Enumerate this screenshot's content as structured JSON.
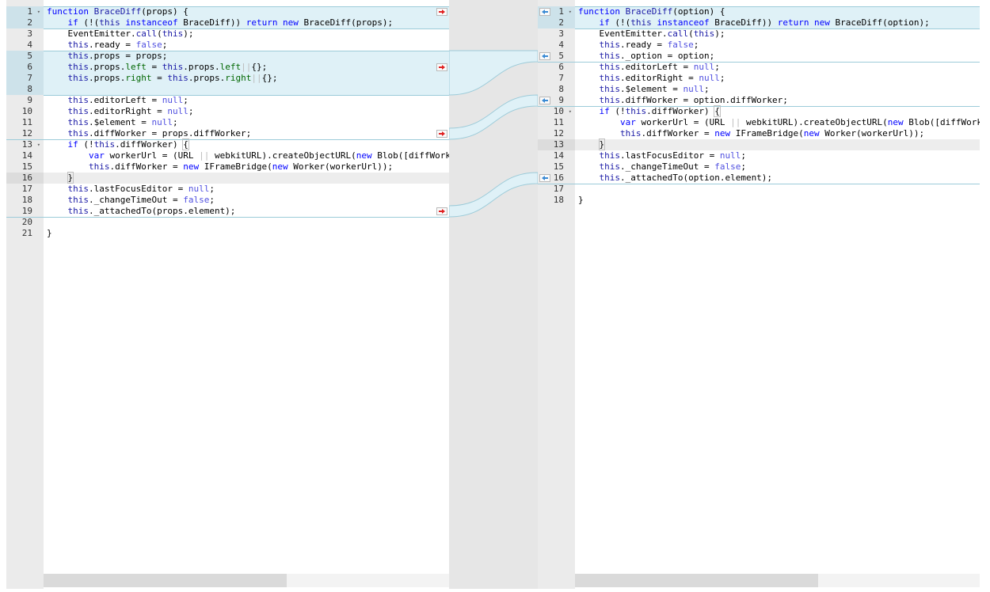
{
  "left": {
    "scroll_thumb_fraction": 0.6,
    "lines": [
      {
        "n": "1",
        "fold": true,
        "segs": [
          [
            "kw",
            "function "
          ],
          [
            "th",
            "BraceDiff"
          ],
          [
            "",
            "(props) {"
          ]
        ]
      },
      {
        "n": "2",
        "segs": [
          [
            "",
            "    "
          ],
          [
            "kw",
            "if"
          ],
          [
            "",
            " (!("
          ],
          [
            "th",
            "this"
          ],
          [
            "",
            " "
          ],
          [
            "kw",
            "instanceof"
          ],
          [
            "",
            " BraceDiff)) "
          ],
          [
            "kw",
            "return new"
          ],
          [
            "",
            " BraceDiff(props);"
          ]
        ]
      },
      {
        "n": "3",
        "segs": [
          [
            "",
            "    EventEmitter."
          ],
          [
            "th",
            "call"
          ],
          [
            "",
            "("
          ],
          [
            "th",
            "this"
          ],
          [
            "",
            ");"
          ]
        ]
      },
      {
        "n": "4",
        "segs": [
          [
            "",
            "    "
          ],
          [
            "th",
            "this"
          ],
          [
            "",
            ".ready = "
          ],
          [
            "nl",
            "false"
          ],
          [
            "",
            ";"
          ]
        ]
      },
      {
        "n": "5",
        "segs": [
          [
            "",
            "    "
          ],
          [
            "th",
            "this"
          ],
          [
            "",
            ".props = props;"
          ]
        ]
      },
      {
        "n": "6",
        "segs": [
          [
            "",
            "    "
          ],
          [
            "th",
            "this"
          ],
          [
            "",
            ".props."
          ],
          [
            "gr",
            "left"
          ],
          [
            "",
            " = "
          ],
          [
            "th",
            "this"
          ],
          [
            "",
            ".props."
          ],
          [
            "gr",
            "left"
          ],
          [
            "guide",
            "||"
          ],
          [
            "",
            "{};"
          ]
        ]
      },
      {
        "n": "7",
        "segs": [
          [
            "",
            "    "
          ],
          [
            "th",
            "this"
          ],
          [
            "",
            ".props."
          ],
          [
            "gr",
            "right"
          ],
          [
            "",
            " = "
          ],
          [
            "th",
            "this"
          ],
          [
            "",
            ".props."
          ],
          [
            "gr",
            "right"
          ],
          [
            "guide",
            "||"
          ],
          [
            "",
            "{};"
          ]
        ]
      },
      {
        "n": "8",
        "segs": []
      },
      {
        "n": "9",
        "segs": [
          [
            "",
            "    "
          ],
          [
            "th",
            "this"
          ],
          [
            "",
            ".editorLeft = "
          ],
          [
            "nl",
            "null"
          ],
          [
            "",
            ";"
          ]
        ]
      },
      {
        "n": "10",
        "segs": [
          [
            "",
            "    "
          ],
          [
            "th",
            "this"
          ],
          [
            "",
            ".editorRight = "
          ],
          [
            "nl",
            "null"
          ],
          [
            "",
            ";"
          ]
        ]
      },
      {
        "n": "11",
        "segs": [
          [
            "",
            "    "
          ],
          [
            "th",
            "this"
          ],
          [
            "",
            ".$element = "
          ],
          [
            "nl",
            "null"
          ],
          [
            "",
            ";"
          ]
        ]
      },
      {
        "n": "12",
        "segs": [
          [
            "",
            "    "
          ],
          [
            "th",
            "this"
          ],
          [
            "",
            ".diffWorker = props.diffWorker;"
          ]
        ]
      },
      {
        "n": "13",
        "fold": true,
        "segs": [
          [
            "",
            "    "
          ],
          [
            "kw",
            "if"
          ],
          [
            "",
            " (!"
          ],
          [
            "th",
            "this"
          ],
          [
            "",
            ".diffWorker) "
          ],
          [
            "brk",
            "{"
          ]
        ]
      },
      {
        "n": "14",
        "segs": [
          [
            "",
            "        "
          ],
          [
            "kw",
            "var"
          ],
          [
            "",
            " workerUrl = (URL "
          ],
          [
            "guide",
            "||"
          ],
          [
            "",
            " webkitURL).createObjectURL("
          ],
          [
            "kw",
            "new"
          ],
          [
            "",
            " Blob([diffWork"
          ]
        ]
      },
      {
        "n": "15",
        "segs": [
          [
            "",
            "        "
          ],
          [
            "th",
            "this"
          ],
          [
            "",
            ".diffWorker = "
          ],
          [
            "kw",
            "new"
          ],
          [
            "",
            " IFrameBridge("
          ],
          [
            "kw",
            "new"
          ],
          [
            "",
            " Worker(workerUrl));"
          ]
        ]
      },
      {
        "n": "16",
        "cur": true,
        "segs": [
          [
            "",
            "    "
          ],
          [
            "brk",
            "}"
          ]
        ]
      },
      {
        "n": "17",
        "segs": [
          [
            "",
            "    "
          ],
          [
            "th",
            "this"
          ],
          [
            "",
            ".lastFocusEditor = "
          ],
          [
            "nl",
            "null"
          ],
          [
            "",
            ";"
          ]
        ]
      },
      {
        "n": "18",
        "segs": [
          [
            "",
            "    "
          ],
          [
            "th",
            "this"
          ],
          [
            "",
            "._changeTimeOut = "
          ],
          [
            "nl",
            "false"
          ],
          [
            "",
            ";"
          ]
        ]
      },
      {
        "n": "19",
        "segs": [
          [
            "",
            "    "
          ],
          [
            "th",
            "this"
          ],
          [
            "",
            "._attachedTo(props.element);"
          ]
        ]
      },
      {
        "n": "20",
        "segs": []
      },
      {
        "n": "21",
        "segs": [
          [
            "",
            "}"
          ]
        ]
      }
    ]
  },
  "right": {
    "scroll_thumb_fraction": 0.6,
    "lines": [
      {
        "n": "1",
        "fold": true,
        "segs": [
          [
            "kw",
            "function "
          ],
          [
            "th",
            "BraceDiff"
          ],
          [
            "",
            "(option) {"
          ]
        ]
      },
      {
        "n": "2",
        "segs": [
          [
            "",
            "    "
          ],
          [
            "kw",
            "if"
          ],
          [
            "",
            " (!("
          ],
          [
            "th",
            "this"
          ],
          [
            "",
            " "
          ],
          [
            "kw",
            "instanceof"
          ],
          [
            "",
            " BraceDiff)) "
          ],
          [
            "kw",
            "return new"
          ],
          [
            "",
            " BraceDiff(option);"
          ]
        ]
      },
      {
        "n": "3",
        "segs": [
          [
            "",
            "    EventEmitter."
          ],
          [
            "th",
            "call"
          ],
          [
            "",
            "("
          ],
          [
            "th",
            "this"
          ],
          [
            "",
            ");"
          ]
        ]
      },
      {
        "n": "4",
        "segs": [
          [
            "",
            "    "
          ],
          [
            "th",
            "this"
          ],
          [
            "",
            ".ready = "
          ],
          [
            "nl",
            "false"
          ],
          [
            "",
            ";"
          ]
        ]
      },
      {
        "n": "5",
        "segs": [
          [
            "",
            "    "
          ],
          [
            "th",
            "this"
          ],
          [
            "",
            "._option = option;"
          ]
        ]
      },
      {
        "n": "6",
        "segs": [
          [
            "",
            "    "
          ],
          [
            "th",
            "this"
          ],
          [
            "",
            ".editorLeft = "
          ],
          [
            "nl",
            "null"
          ],
          [
            "",
            ";"
          ]
        ]
      },
      {
        "n": "7",
        "segs": [
          [
            "",
            "    "
          ],
          [
            "th",
            "this"
          ],
          [
            "",
            ".editorRight = "
          ],
          [
            "nl",
            "null"
          ],
          [
            "",
            ";"
          ]
        ]
      },
      {
        "n": "8",
        "segs": [
          [
            "",
            "    "
          ],
          [
            "th",
            "this"
          ],
          [
            "",
            ".$element = "
          ],
          [
            "nl",
            "null"
          ],
          [
            "",
            ";"
          ]
        ]
      },
      {
        "n": "9",
        "segs": [
          [
            "",
            "    "
          ],
          [
            "th",
            "this"
          ],
          [
            "",
            ".diffWorker = option.diffWorker;"
          ]
        ]
      },
      {
        "n": "10",
        "fold": true,
        "segs": [
          [
            "",
            "    "
          ],
          [
            "kw",
            "if"
          ],
          [
            "",
            " (!"
          ],
          [
            "th",
            "this"
          ],
          [
            "",
            ".diffWorker) "
          ],
          [
            "brk",
            "{"
          ]
        ]
      },
      {
        "n": "11",
        "segs": [
          [
            "",
            "        "
          ],
          [
            "kw",
            "var"
          ],
          [
            "",
            " workerUrl = (URL "
          ],
          [
            "guide",
            "||"
          ],
          [
            "",
            " webkitURL).createObjectURL("
          ],
          [
            "kw",
            "new"
          ],
          [
            "",
            " Blob([diffWork"
          ]
        ]
      },
      {
        "n": "12",
        "segs": [
          [
            "",
            "        "
          ],
          [
            "th",
            "this"
          ],
          [
            "",
            ".diffWorker = "
          ],
          [
            "kw",
            "new"
          ],
          [
            "",
            " IFrameBridge("
          ],
          [
            "kw",
            "new"
          ],
          [
            "",
            " Worker(workerUrl));"
          ]
        ]
      },
      {
        "n": "13",
        "cur": true,
        "segs": [
          [
            "",
            "    "
          ],
          [
            "brk",
            "}"
          ]
        ]
      },
      {
        "n": "14",
        "segs": [
          [
            "",
            "    "
          ],
          [
            "th",
            "this"
          ],
          [
            "",
            ".lastFocusEditor = "
          ],
          [
            "nl",
            "null"
          ],
          [
            "",
            ";"
          ]
        ]
      },
      {
        "n": "15",
        "segs": [
          [
            "",
            "    "
          ],
          [
            "th",
            "this"
          ],
          [
            "",
            "._changeTimeOut = "
          ],
          [
            "nl",
            "false"
          ],
          [
            "",
            ";"
          ]
        ]
      },
      {
        "n": "16",
        "segs": [
          [
            "",
            "    "
          ],
          [
            "th",
            "this"
          ],
          [
            "",
            "._attachedTo(option.element);"
          ]
        ]
      },
      {
        "n": "17",
        "segs": []
      },
      {
        "n": "18",
        "segs": [
          [
            "",
            "}"
          ]
        ]
      }
    ]
  },
  "diff_colors": {
    "fill": "#dff1f7",
    "stroke": "#9ccbd9"
  }
}
